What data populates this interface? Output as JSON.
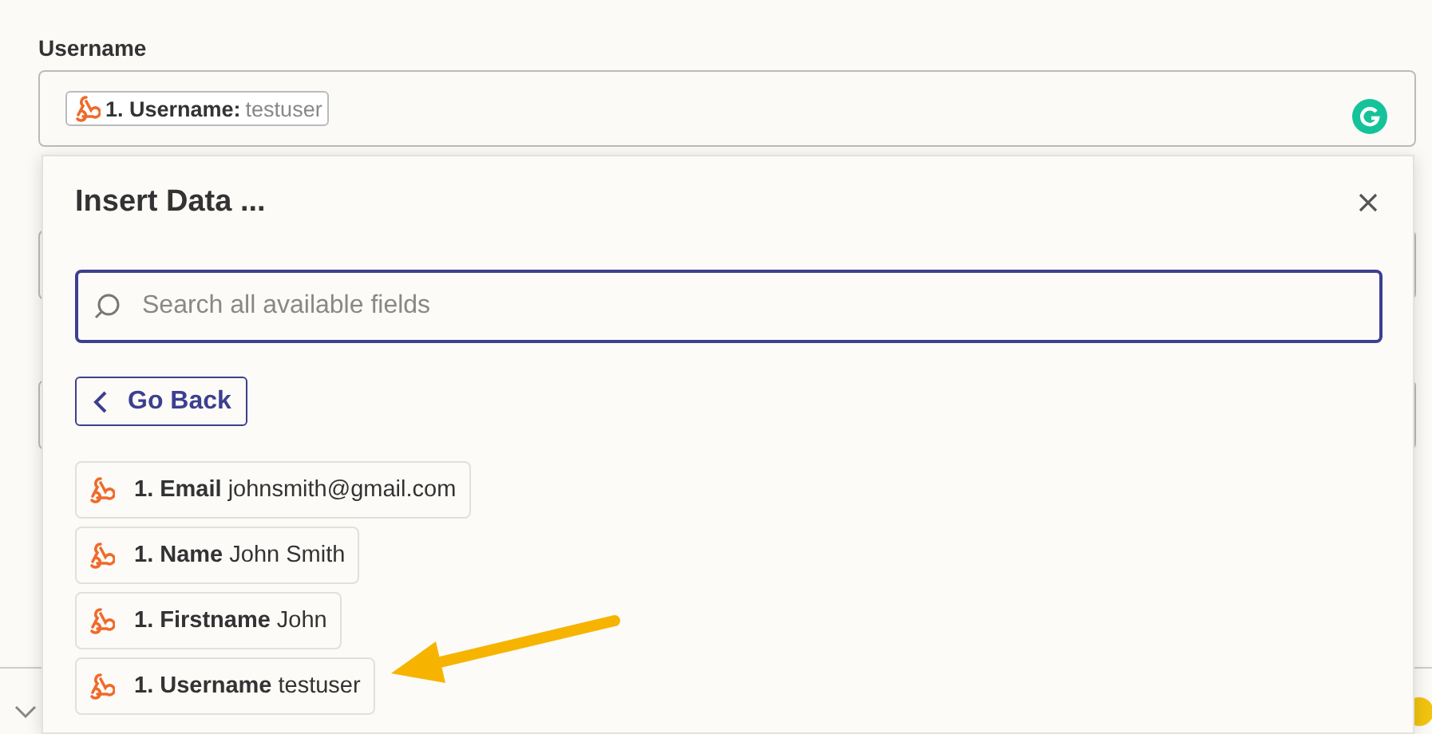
{
  "field": {
    "label": "Username",
    "token": {
      "label": "1. Username:",
      "value": "testuser"
    }
  },
  "popup": {
    "title": "Insert Data ...",
    "search": {
      "placeholder": "Search all available fields"
    },
    "back_button": "Go Back",
    "items": [
      {
        "label": "1. Email",
        "value": "johnsmith@gmail.com"
      },
      {
        "label": "1. Name",
        "value": "John Smith"
      },
      {
        "label": "1. Firstname",
        "value": "John"
      },
      {
        "label": "1. Username",
        "value": "testuser"
      }
    ]
  }
}
